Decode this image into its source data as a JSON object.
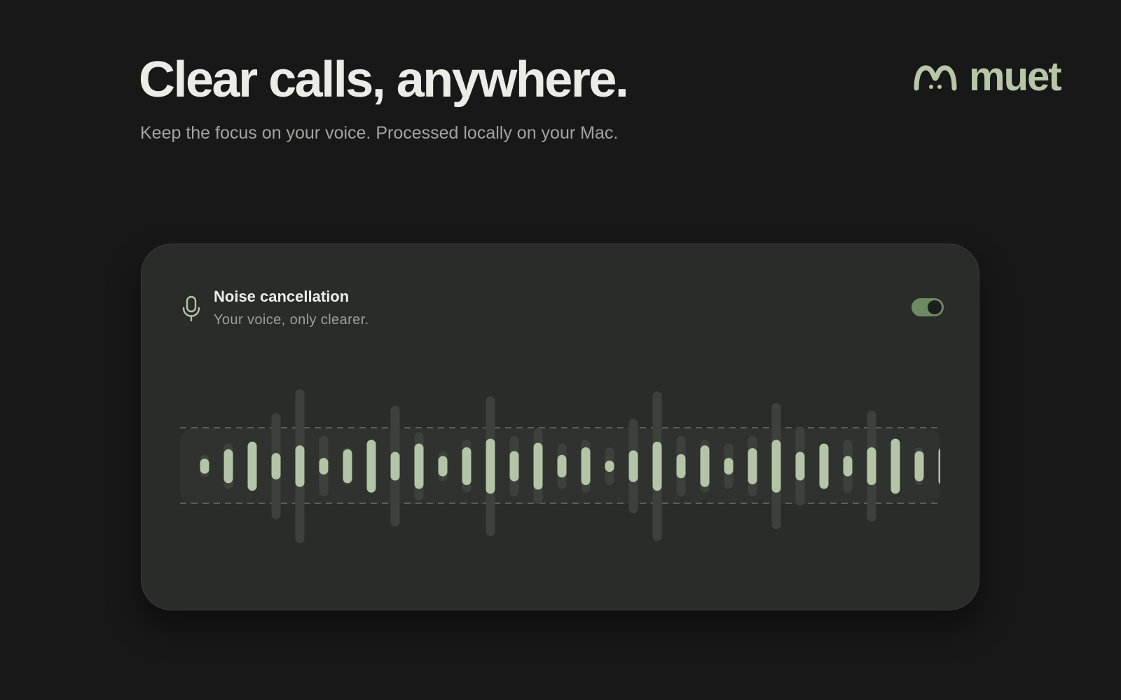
{
  "hero": {
    "headline": "Clear calls, anywhere.",
    "subtitle": "Keep the focus on your voice. Processed locally on your Mac."
  },
  "brand": {
    "name": "muet",
    "icon": "muet-logo-icon",
    "color": "#b6c6a6"
  },
  "card": {
    "icon": "microphone-icon",
    "title": "Noise cancellation",
    "description": "Your voice, only clearer.",
    "toggle": {
      "state": "on",
      "color": "#6e8a63"
    }
  },
  "waveform": {
    "raw_color": "#3d403c",
    "clean_color": "#b4c4a6",
    "raw_levels": [
      0.3,
      0.6,
      0.4,
      1.4,
      2.04,
      0.8,
      0.5,
      0.5,
      1.6,
      0.9,
      0.4,
      0.7,
      1.85,
      0.8,
      1.0,
      0.6,
      0.7,
      0.5,
      1.25,
      1.98,
      0.8,
      0.7,
      0.6,
      0.8,
      1.67,
      1.05,
      0.6,
      0.7,
      1.47,
      0.6,
      0.5,
      0.5
    ],
    "clean_levels": [
      0.2,
      0.45,
      0.65,
      0.35,
      0.55,
      0.22,
      0.45,
      0.7,
      0.38,
      0.6,
      0.27,
      0.5,
      0.73,
      0.4,
      0.62,
      0.3,
      0.5,
      0.15,
      0.42,
      0.65,
      0.32,
      0.55,
      0.22,
      0.48,
      0.7,
      0.38,
      0.6,
      0.27,
      0.5,
      0.73,
      0.4,
      0.5
    ]
  }
}
